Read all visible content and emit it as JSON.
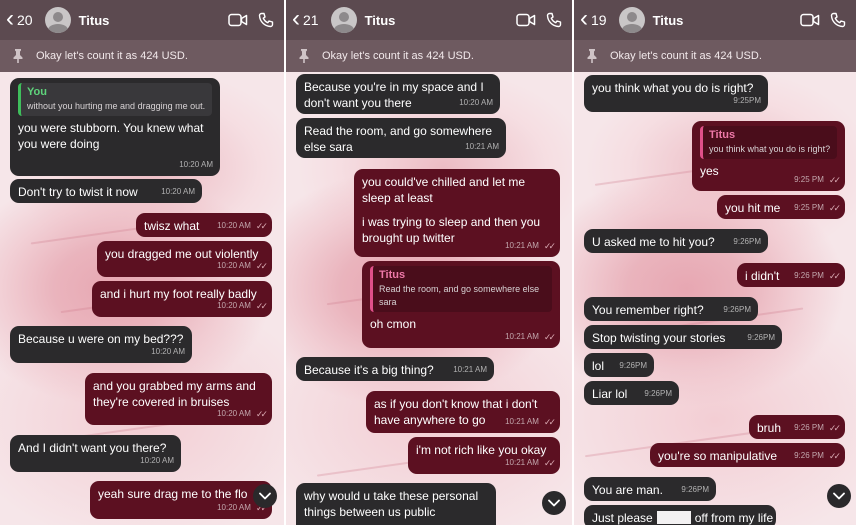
{
  "panels": [
    {
      "back_count": "20",
      "contact": "Titus",
      "pinned": "Okay let's count it as 424 USD.",
      "messages": [
        {
          "reply_name": "You",
          "reply_text": "without you hurting me and dragging me out.",
          "text": "you were stubborn. You knew what you were doing",
          "time": "10:20 AM"
        },
        {
          "text": "Don't try to twist it now",
          "time": "10:20 AM"
        },
        {
          "text": "twisz what",
          "time": "10:20 AM"
        },
        {
          "text": "you dragged me out violently",
          "time": "10:20 AM"
        },
        {
          "text": "and i hurt my foot really badly",
          "time": "10:20 AM"
        },
        {
          "text": "Because u were on my bed???",
          "time": "10:20 AM"
        },
        {
          "text": "and you grabbed my arms and they're covered in bruises",
          "time": "10:20 AM"
        },
        {
          "text": "And I didn't want you there?",
          "time": "10:20 AM"
        },
        {
          "text": "yeah sure drag me to the flo",
          "time": "10:20 AM"
        }
      ]
    },
    {
      "back_count": "21",
      "contact": "Titus",
      "pinned": "Okay let's count it as 424 USD.",
      "messages": [
        {
          "text": "Because you're in my space and I don't want you there",
          "time": "10:20 AM"
        },
        {
          "text": "Read the room, and go somewhere else sara",
          "time": "10:21 AM"
        },
        {
          "text": "you could've chilled and let me sleep at least",
          "text2": "i was trying to sleep and then you brought up twitter",
          "time": "10:21 AM"
        },
        {
          "reply_name": "Titus",
          "reply_text": "Read the room, and go somewhere else sara",
          "text": "oh cmon",
          "time": "10:21 AM"
        },
        {
          "text": "Because it's a big thing?",
          "time": "10:21 AM"
        },
        {
          "text": "as if you don't know that i don't have anywhere to go",
          "time": "10:21 AM"
        },
        {
          "text": "i'm not rich like you okay",
          "time": "10:21 AM"
        },
        {
          "text": "why would u take these personal things between us public"
        }
      ]
    },
    {
      "back_count": "19",
      "contact": "Titus",
      "pinned": "Okay let's count it as 424 USD.",
      "messages": [
        {
          "text": "you think what you do is right?",
          "time": "9:25PM"
        },
        {
          "reply_name": "Titus",
          "reply_text": "you think what you do is right?",
          "text": "yes",
          "time": "9:25 PM"
        },
        {
          "text": "you hit me",
          "time": "9:25 PM"
        },
        {
          "text": "U asked me to hit you?",
          "time": "9:26PM"
        },
        {
          "text": "i didn't",
          "time": "9:26 PM"
        },
        {
          "text": "You remember right?",
          "time": "9:26PM"
        },
        {
          "text": "Stop twisting your stories",
          "time": "9:26PM"
        },
        {
          "text": "lol",
          "time": "9:26PM"
        },
        {
          "text": "Liar lol",
          "time": "9:26PM"
        },
        {
          "text": "bruh",
          "time": "9:26 PM"
        },
        {
          "text": "you're so manipulative",
          "time": "9:26 PM"
        },
        {
          "text": "You are man.",
          "time": "9:26PM"
        },
        {
          "text": "Just please",
          "text2": "off from my life"
        }
      ]
    }
  ],
  "colors": {
    "header": "#5c4a50",
    "pinbar": "#6e5a60",
    "incoming_bubble": "#2b2a2c",
    "outgoing_bubble": "#5c1021",
    "reply_accent_you": "#3fbf5c",
    "reply_accent_titus": "#e0508a"
  },
  "icons": [
    "back-chevron-icon",
    "avatar-icon",
    "video-call-icon",
    "phone-icon",
    "pin-icon",
    "read-ticks-icon",
    "scroll-down-icon"
  ]
}
